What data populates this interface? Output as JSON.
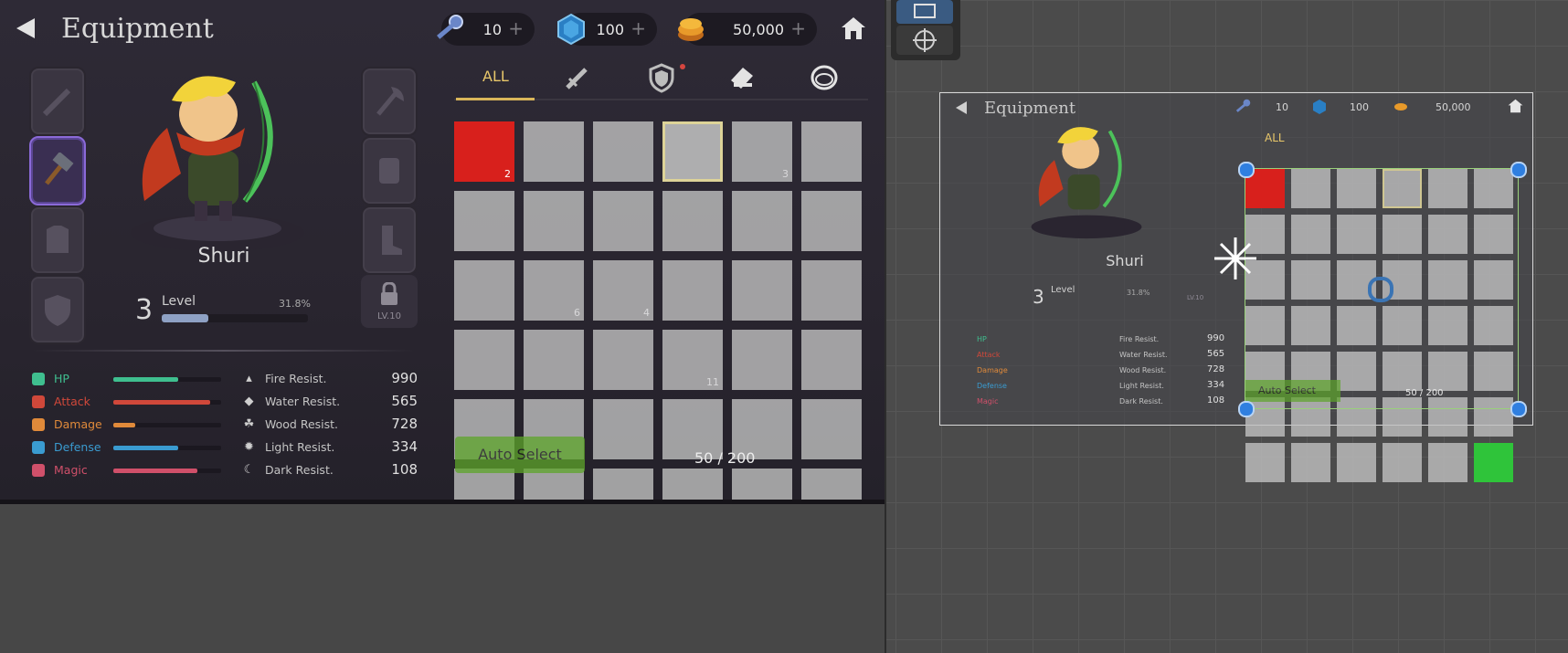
{
  "game": {
    "title": "Equipment",
    "currencies": [
      {
        "name": "keys",
        "value": "10"
      },
      {
        "name": "gems",
        "value": "100"
      },
      {
        "name": "gold",
        "value": "50,000"
      }
    ],
    "plus": "+",
    "hero": {
      "name": "Shuri",
      "level": "3",
      "level_label": "Level",
      "level_percent": "31.8%",
      "level_progress": 0.318
    },
    "lock_label": "LV.10",
    "stats": [
      {
        "name": "HP",
        "fill": 0.6,
        "color": "#3fbf8f"
      },
      {
        "name": "Attack",
        "fill": 0.9,
        "color": "#d0483a"
      },
      {
        "name": "Damage",
        "fill": 0.2,
        "color": "#e08a3a"
      },
      {
        "name": "Defense",
        "fill": 0.6,
        "color": "#3a9bd0"
      },
      {
        "name": "Magic",
        "fill": 0.78,
        "color": "#d0506a"
      }
    ],
    "resistances": [
      {
        "name": "Fire Resist.",
        "value": "990"
      },
      {
        "name": "Water Resist.",
        "value": "565"
      },
      {
        "name": "Wood Resist.",
        "value": "728"
      },
      {
        "name": "Light Resist.",
        "value": "334"
      },
      {
        "name": "Dark Resist.",
        "value": "108"
      }
    ],
    "tabs": {
      "all": "ALL"
    },
    "grid_counts": {
      "c0": "2",
      "c4": "3",
      "c13": "6",
      "c14": "4",
      "c21": "11"
    },
    "auto_select": "Auto Select",
    "item_count": "50 / 200"
  },
  "scene": {
    "title": "Equipment",
    "currencies": [
      "10",
      "100",
      "50,000"
    ],
    "hero_name": "Shuri",
    "level": "3",
    "level_label": "Level",
    "level_percent": "31.8%",
    "lock_label": "LV.10",
    "stats": [
      "HP",
      "Attack",
      "Damage",
      "Defense",
      "Magic"
    ],
    "resistances": [
      "Fire Resist.",
      "Water Resist.",
      "Wood Resist.",
      "Light Resist.",
      "Dark Resist."
    ],
    "res_values": [
      "990",
      "565",
      "728",
      "334",
      "108"
    ],
    "tab_all": "ALL",
    "auto_select": "Auto Select",
    "item_count": "50 / 200"
  }
}
